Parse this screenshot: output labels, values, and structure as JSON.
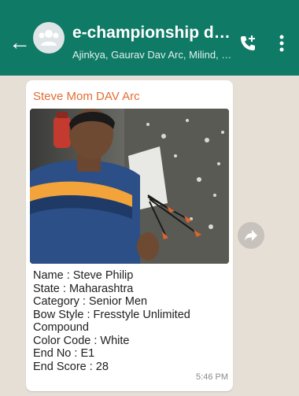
{
  "header": {
    "title": "e-championship demo...",
    "subtitle": "Ajinkya, Gaurav Dav Arc, Milind, P...",
    "icons": {
      "back": "arrow-left-icon",
      "avatar": "group-avatar-icon",
      "call": "add-call-icon",
      "menu": "more-vertical-icon"
    }
  },
  "message": {
    "sender": "Steve Mom DAV Arc",
    "image": "photo of archer holding arrows in front of target",
    "lines": [
      "Name : Steve Philip",
      "State : Maharashtra",
      "Category : Senior Men",
      "Bow Style : Fresstyle Unlimited",
      "Compound",
      "Color Code : White",
      "End No : E1",
      "End Score : 28"
    ],
    "time": "5:46 PM"
  },
  "colors": {
    "header_bg": "#0f7a66",
    "chat_bg": "#e6dfd6",
    "sender_name": "#e36d32"
  }
}
